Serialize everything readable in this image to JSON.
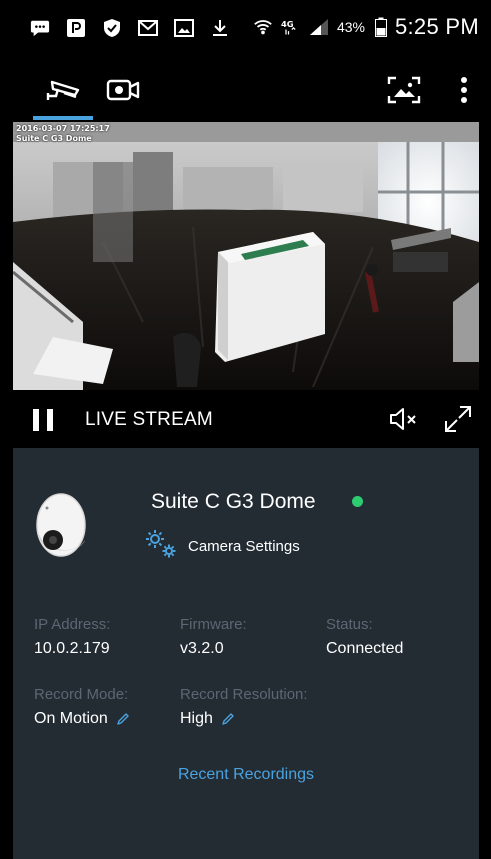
{
  "status_bar": {
    "battery_percent": "43%",
    "time": "5:25 PM"
  },
  "toolbar": {
    "tabs": [
      {
        "icon": "security-camera-icon",
        "selected": true
      },
      {
        "icon": "video-camera-icon",
        "selected": false
      }
    ],
    "snapshot_icon": "snapshot-icon",
    "menu_icon": "more-vert-icon",
    "accent_color": "#4aa3df"
  },
  "feed": {
    "timestamp": "2016-03-07 17:25:17",
    "camera_label": "Suite C G3 Dome"
  },
  "live_bar": {
    "label": "LIVE STREAM"
  },
  "camera": {
    "name": "Suite C G3 Dome",
    "online_color": "#2ecc71",
    "settings_label": "Camera Settings",
    "fields": {
      "ip_address": {
        "label": "IP Address:",
        "value": "10.0.2.179"
      },
      "firmware": {
        "label": "Firmware:",
        "value": "v3.2.0"
      },
      "status": {
        "label": "Status:",
        "value": "Connected"
      },
      "record_mode": {
        "label": "Record Mode:",
        "value": "On Motion"
      },
      "record_resolution": {
        "label": "Record Resolution:",
        "value": "High"
      }
    },
    "recent_recordings_label": "Recent Recordings"
  }
}
